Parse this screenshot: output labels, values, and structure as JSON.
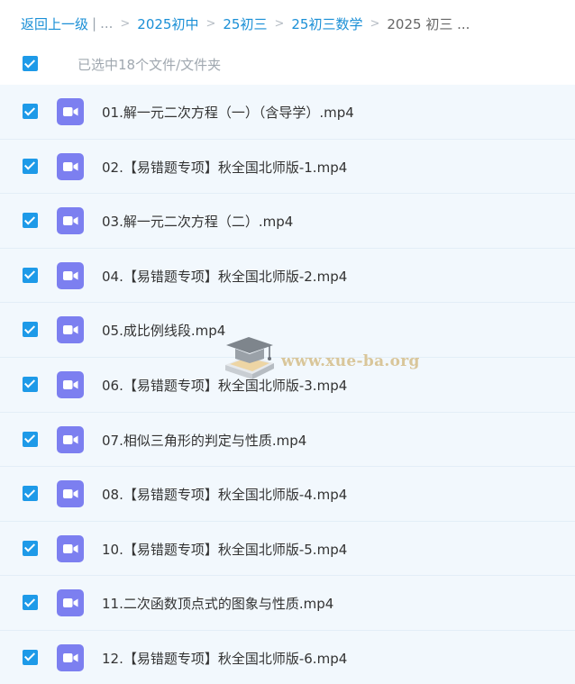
{
  "breadcrumb": {
    "back_label": "返回上一级",
    "divider": "|",
    "ellipsis": "...",
    "separator": ">",
    "items": [
      "2025初中",
      "25初三",
      "25初三数学"
    ],
    "current": "2025 初三 ..."
  },
  "selection": {
    "all_checked": true,
    "label": "已选中18个文件/文件夹"
  },
  "files": [
    {
      "name": "01.解一元二次方程（一）（含导学）.mp4",
      "checked": true,
      "icon": "video-file-icon"
    },
    {
      "name": "02.【易错题专项】秋全国北师版-1.mp4",
      "checked": true,
      "icon": "video-file-icon"
    },
    {
      "name": "03.解一元二次方程（二）.mp4",
      "checked": true,
      "icon": "video-file-icon"
    },
    {
      "name": "04.【易错题专项】秋全国北师版-2.mp4",
      "checked": true,
      "icon": "video-file-icon"
    },
    {
      "name": "05.成比例线段.mp4",
      "checked": true,
      "icon": "video-file-icon"
    },
    {
      "name": "06.【易错题专项】秋全国北师版-3.mp4",
      "checked": true,
      "icon": "video-file-icon"
    },
    {
      "name": "07.相似三角形的判定与性质.mp4",
      "checked": true,
      "icon": "video-file-icon"
    },
    {
      "name": "08.【易错题专项】秋全国北师版-4.mp4",
      "checked": true,
      "icon": "video-file-icon"
    },
    {
      "name": "10.【易错题专项】秋全国北师版-5.mp4",
      "checked": true,
      "icon": "video-file-icon"
    },
    {
      "name": "11.二次函数顶点式的图象与性质.mp4",
      "checked": true,
      "icon": "video-file-icon"
    },
    {
      "name": "12.【易错题专项】秋全国北师版-6.mp4",
      "checked": true,
      "icon": "video-file-icon"
    }
  ],
  "watermark": {
    "text": "www.xue-ba.org"
  },
  "colors": {
    "accent": "#1e9ae8",
    "link": "#1a8fd6",
    "row_background": "#f2f8fd",
    "video_icon": "#7c7ff0"
  }
}
